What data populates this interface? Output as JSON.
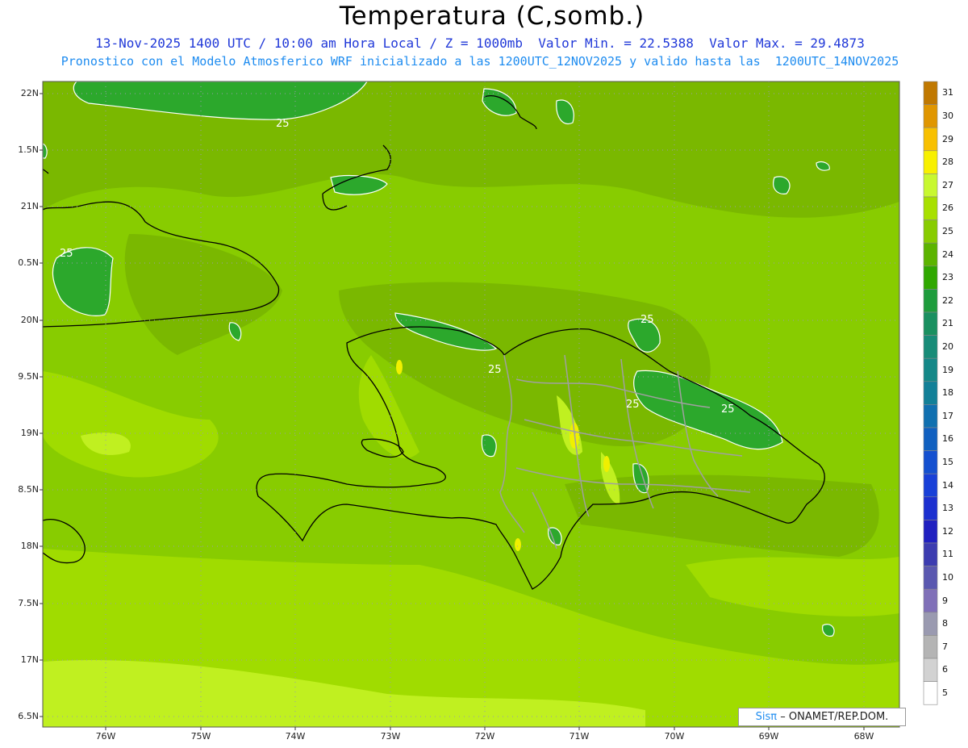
{
  "header": {
    "title": "Temperatura (C,somb.)",
    "subtitle_line1": "13-Nov-2025 1400 UTC / 10:00 am Hora Local / Z = 1000mb  Valor Min. = 22.5388  Valor Max. = 29.4873",
    "subtitle_line2": "Pronostico con el Modelo Atmosferico WRF inicializado a las 1200UTC_12NOV2025 y valido hasta las  1200UTC_14NOV2025"
  },
  "axes": {
    "lat_ticks": [
      "22N",
      "1.5N",
      "21N",
      "0.5N",
      "20N",
      "9.5N",
      "19N",
      "8.5N",
      "18N",
      "7.5N",
      "17N",
      "6.5N"
    ],
    "lon_ticks": [
      "76W",
      "75W",
      "74W",
      "73W",
      "72W",
      "71W",
      "70W",
      "69W",
      "68W"
    ]
  },
  "colorbar": {
    "labels": [
      "31",
      "30",
      "29",
      "28",
      "27",
      "26",
      "25",
      "24",
      "23",
      "22",
      "21",
      "20",
      "19",
      "18",
      "17",
      "16",
      "15",
      "14",
      "13",
      "12",
      "11",
      "10",
      "9",
      "8",
      "7",
      "6",
      "5"
    ],
    "colors": [
      "#c07800",
      "#e09600",
      "#f8c000",
      "#f8f000",
      "#c8f830",
      "#a8e000",
      "#88cc00",
      "#5cb400",
      "#30a800",
      "#1e9c3c",
      "#1a9060",
      "#188c78",
      "#148888",
      "#128098",
      "#1070b0",
      "#1060c0",
      "#1450d0",
      "#1840d8",
      "#1c30d0",
      "#2020c0",
      "#3c3cb0",
      "#5a58b0",
      "#8070b8",
      "#9a9ab0",
      "#b4b4b4",
      "#d2d2d2",
      "#ffffff"
    ]
  },
  "contour_labels": [
    "25",
    "25",
    "25",
    "25",
    "25",
    "25"
  ],
  "credit": {
    "brand": "Sisπ",
    "text": "– ONAMET/REP.DOM."
  },
  "palette": {
    "background_field": "#88cc00",
    "warm_field": "#a8e000",
    "hot_field": "#c8f830",
    "cool_field": "#5cb400",
    "coolest_field": "#2ca82c",
    "coastline": "#000000",
    "borders": "#a0a0a0"
  }
}
